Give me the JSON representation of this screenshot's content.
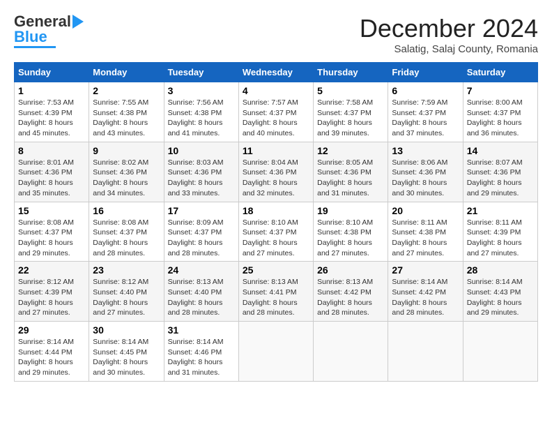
{
  "header": {
    "logo_general": "General",
    "logo_blue": "Blue",
    "month_title": "December 2024",
    "location": "Salatig, Salaj County, Romania"
  },
  "weekdays": [
    "Sunday",
    "Monday",
    "Tuesday",
    "Wednesday",
    "Thursday",
    "Friday",
    "Saturday"
  ],
  "weeks": [
    [
      {
        "day": "1",
        "sunrise": "7:53 AM",
        "sunset": "4:39 PM",
        "daylight": "8 hours and 45 minutes."
      },
      {
        "day": "2",
        "sunrise": "7:55 AM",
        "sunset": "4:38 PM",
        "daylight": "8 hours and 43 minutes."
      },
      {
        "day": "3",
        "sunrise": "7:56 AM",
        "sunset": "4:38 PM",
        "daylight": "8 hours and 41 minutes."
      },
      {
        "day": "4",
        "sunrise": "7:57 AM",
        "sunset": "4:37 PM",
        "daylight": "8 hours and 40 minutes."
      },
      {
        "day": "5",
        "sunrise": "7:58 AM",
        "sunset": "4:37 PM",
        "daylight": "8 hours and 39 minutes."
      },
      {
        "day": "6",
        "sunrise": "7:59 AM",
        "sunset": "4:37 PM",
        "daylight": "8 hours and 37 minutes."
      },
      {
        "day": "7",
        "sunrise": "8:00 AM",
        "sunset": "4:37 PM",
        "daylight": "8 hours and 36 minutes."
      }
    ],
    [
      {
        "day": "8",
        "sunrise": "8:01 AM",
        "sunset": "4:36 PM",
        "daylight": "8 hours and 35 minutes."
      },
      {
        "day": "9",
        "sunrise": "8:02 AM",
        "sunset": "4:36 PM",
        "daylight": "8 hours and 34 minutes."
      },
      {
        "day": "10",
        "sunrise": "8:03 AM",
        "sunset": "4:36 PM",
        "daylight": "8 hours and 33 minutes."
      },
      {
        "day": "11",
        "sunrise": "8:04 AM",
        "sunset": "4:36 PM",
        "daylight": "8 hours and 32 minutes."
      },
      {
        "day": "12",
        "sunrise": "8:05 AM",
        "sunset": "4:36 PM",
        "daylight": "8 hours and 31 minutes."
      },
      {
        "day": "13",
        "sunrise": "8:06 AM",
        "sunset": "4:36 PM",
        "daylight": "8 hours and 30 minutes."
      },
      {
        "day": "14",
        "sunrise": "8:07 AM",
        "sunset": "4:36 PM",
        "daylight": "8 hours and 29 minutes."
      }
    ],
    [
      {
        "day": "15",
        "sunrise": "8:08 AM",
        "sunset": "4:37 PM",
        "daylight": "8 hours and 29 minutes."
      },
      {
        "day": "16",
        "sunrise": "8:08 AM",
        "sunset": "4:37 PM",
        "daylight": "8 hours and 28 minutes."
      },
      {
        "day": "17",
        "sunrise": "8:09 AM",
        "sunset": "4:37 PM",
        "daylight": "8 hours and 28 minutes."
      },
      {
        "day": "18",
        "sunrise": "8:10 AM",
        "sunset": "4:37 PM",
        "daylight": "8 hours and 27 minutes."
      },
      {
        "day": "19",
        "sunrise": "8:10 AM",
        "sunset": "4:38 PM",
        "daylight": "8 hours and 27 minutes."
      },
      {
        "day": "20",
        "sunrise": "8:11 AM",
        "sunset": "4:38 PM",
        "daylight": "8 hours and 27 minutes."
      },
      {
        "day": "21",
        "sunrise": "8:11 AM",
        "sunset": "4:39 PM",
        "daylight": "8 hours and 27 minutes."
      }
    ],
    [
      {
        "day": "22",
        "sunrise": "8:12 AM",
        "sunset": "4:39 PM",
        "daylight": "8 hours and 27 minutes."
      },
      {
        "day": "23",
        "sunrise": "8:12 AM",
        "sunset": "4:40 PM",
        "daylight": "8 hours and 27 minutes."
      },
      {
        "day": "24",
        "sunrise": "8:13 AM",
        "sunset": "4:40 PM",
        "daylight": "8 hours and 28 minutes."
      },
      {
        "day": "25",
        "sunrise": "8:13 AM",
        "sunset": "4:41 PM",
        "daylight": "8 hours and 28 minutes."
      },
      {
        "day": "26",
        "sunrise": "8:13 AM",
        "sunset": "4:42 PM",
        "daylight": "8 hours and 28 minutes."
      },
      {
        "day": "27",
        "sunrise": "8:14 AM",
        "sunset": "4:42 PM",
        "daylight": "8 hours and 28 minutes."
      },
      {
        "day": "28",
        "sunrise": "8:14 AM",
        "sunset": "4:43 PM",
        "daylight": "8 hours and 29 minutes."
      }
    ],
    [
      {
        "day": "29",
        "sunrise": "8:14 AM",
        "sunset": "4:44 PM",
        "daylight": "8 hours and 29 minutes."
      },
      {
        "day": "30",
        "sunrise": "8:14 AM",
        "sunset": "4:45 PM",
        "daylight": "8 hours and 30 minutes."
      },
      {
        "day": "31",
        "sunrise": "8:14 AM",
        "sunset": "4:46 PM",
        "daylight": "8 hours and 31 minutes."
      },
      null,
      null,
      null,
      null
    ]
  ],
  "labels": {
    "sunrise": "Sunrise:",
    "sunset": "Sunset:",
    "daylight": "Daylight:"
  }
}
